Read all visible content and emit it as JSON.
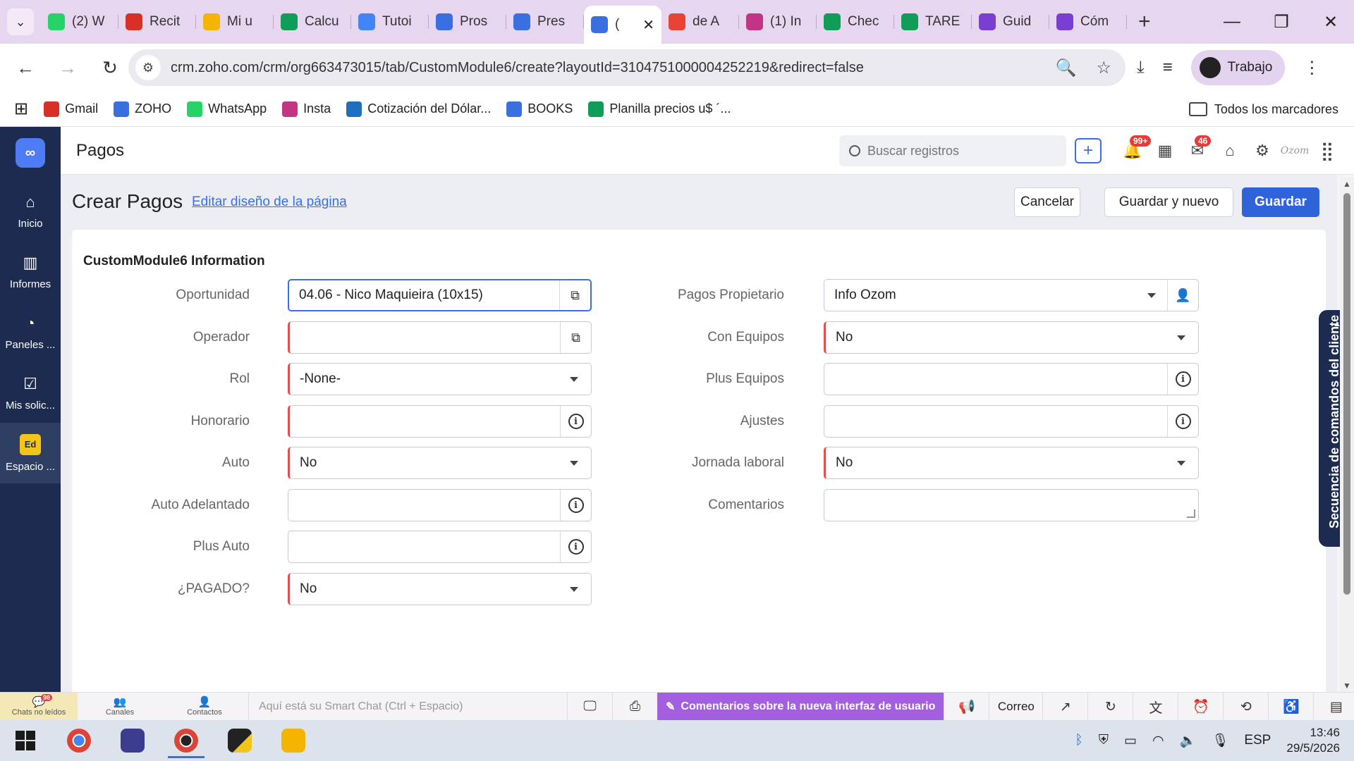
{
  "browser": {
    "tabs": [
      {
        "label": "(2) W",
        "icon": "whatsapp-icon",
        "color": "#25d366"
      },
      {
        "label": "Recit",
        "icon": "gmail-icon",
        "color": "#d93025"
      },
      {
        "label": "Mi u",
        "icon": "drive-icon",
        "color": "#f4b400"
      },
      {
        "label": "Calcu",
        "icon": "sheets-icon",
        "color": "#0f9d58"
      },
      {
        "label": "Tutoi",
        "icon": "docs-icon",
        "color": "#4285f4"
      },
      {
        "label": "Pros",
        "icon": "zoho-crm-icon",
        "color": "#3a6fe2"
      },
      {
        "label": "Pres",
        "icon": "zoho-crm-icon",
        "color": "#3a6fe2"
      },
      {
        "label": "(",
        "icon": "zoho-crm-icon",
        "color": "#3a6fe2",
        "active": true
      },
      {
        "label": "de A",
        "icon": "maps-icon",
        "color": "#ea4335"
      },
      {
        "label": "(1) In",
        "icon": "instagram-icon",
        "color": "#c13584"
      },
      {
        "label": "Chec",
        "icon": "sheets-icon",
        "color": "#0f9d58"
      },
      {
        "label": "TARE",
        "icon": "sheets-icon",
        "color": "#0f9d58"
      },
      {
        "label": "Guid",
        "icon": "g-icon",
        "color": "#7a3fd1"
      },
      {
        "label": "Cóm",
        "icon": "g-icon",
        "color": "#7a3fd1"
      }
    ],
    "url": "crm.zoho.com/crm/org663473015/tab/CustomModule6/create?layoutId=3104751000004252219&redirect=false",
    "profile_label": "Trabajo",
    "bookmarks": [
      {
        "label": "Gmail",
        "color": "#d93025"
      },
      {
        "label": "ZOHO",
        "color": "#3a6fe2"
      },
      {
        "label": "WhatsApp",
        "color": "#25d366"
      },
      {
        "label": "Insta",
        "color": "#c13584"
      },
      {
        "label": "Cotización del Dólar...",
        "color": "#1e6fbf"
      },
      {
        "label": "BOOKS",
        "color": "#3a6fe2"
      },
      {
        "label": "Planilla precios u$ ´...",
        "color": "#0f9d58"
      }
    ],
    "all_bookmarks_label": "Todos los marcadores"
  },
  "sidebar": {
    "items": [
      {
        "label": "Inicio",
        "icon": "home-icon"
      },
      {
        "label": "Informes",
        "icon": "reports-icon"
      },
      {
        "label": "Paneles ...",
        "icon": "dashboards-icon"
      },
      {
        "label": "Mis solic...",
        "icon": "requests-icon"
      },
      {
        "label": "Espacio ...",
        "icon": "workspace-icon",
        "badge": "Ed",
        "active": true
      }
    ]
  },
  "header": {
    "module": "Pagos",
    "search_placeholder": "Buscar registros",
    "notifications_badge": "99+",
    "mail_badge": "46",
    "org_logo_text": "Ozom"
  },
  "page": {
    "title": "Crear Pagos",
    "edit_layout_link": "Editar diseño de la página",
    "cancel_label": "Cancelar",
    "save_new_label": "Guardar y nuevo",
    "save_label": "Guardar",
    "section_title": "CustomModule6 Information"
  },
  "form_left": [
    {
      "label": "Oportunidad",
      "value": "04.06 - Nico Maquieira (10x15)",
      "type": "lookup",
      "required": false,
      "focused": true
    },
    {
      "label": "Operador",
      "value": "",
      "type": "lookup",
      "required": true
    },
    {
      "label": "Rol",
      "value": "-None-",
      "type": "select",
      "required": true
    },
    {
      "label": "Honorario",
      "value": "",
      "type": "info",
      "required": true
    },
    {
      "label": "Auto",
      "value": "No",
      "type": "select",
      "required": true
    },
    {
      "label": "Auto Adelantado",
      "value": "",
      "type": "info",
      "required": false
    },
    {
      "label": "Plus Auto",
      "value": "",
      "type": "info",
      "required": false
    },
    {
      "label": "¿PAGADO?",
      "value": "No",
      "type": "select",
      "required": true
    }
  ],
  "form_right": [
    {
      "label": "Pagos Propietario",
      "value": "Info Ozom",
      "type": "owner",
      "required": false
    },
    {
      "label": "Con Equipos",
      "value": "No",
      "type": "select",
      "required": true
    },
    {
      "label": "Plus Equipos",
      "value": "",
      "type": "info",
      "required": false
    },
    {
      "label": "Ajustes",
      "value": "",
      "type": "info",
      "required": false
    },
    {
      "label": "Jornada laboral",
      "value": "No",
      "type": "select",
      "required": true
    },
    {
      "label": "Comentarios",
      "value": "",
      "type": "textarea",
      "required": false
    }
  ],
  "command_panel_label": "Secuencia de comandos del cliente",
  "bottom_bar": {
    "chats_label": "Chats no leídos",
    "chats_badge": "98",
    "channels_label": "Canales",
    "contacts_label": "Contactos",
    "smartchat_placeholder": "Aquí está su Smart Chat (Ctrl + Espacio)",
    "feedback_label": "Comentarios sobre la nueva interfaz de usuario",
    "mail_label": "Correo"
  },
  "taskbar": {
    "language": "ESP",
    "time": "13:46",
    "date": "29/5/2026"
  },
  "colors": {
    "accent": "#2f63d9",
    "sidebar": "#1c2b4f",
    "required": "#e74c4c",
    "feedback": "#a45fe0"
  }
}
